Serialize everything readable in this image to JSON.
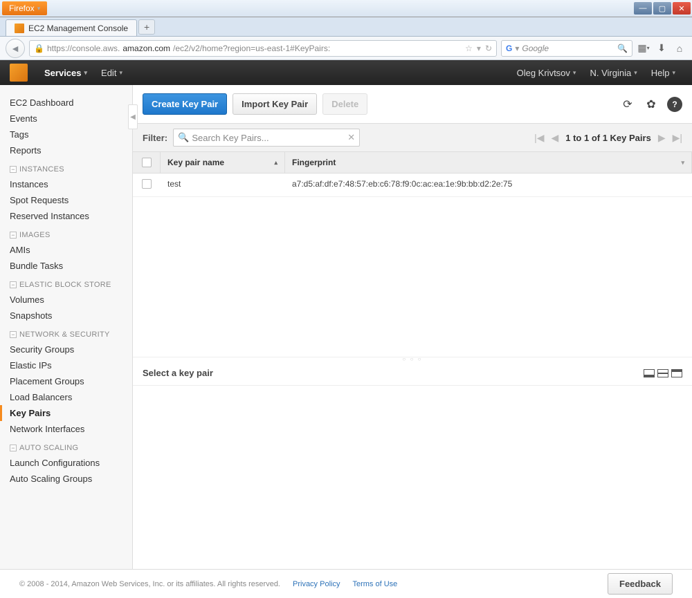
{
  "browser": {
    "app_button": "Firefox",
    "tab_title": "EC2 Management Console",
    "url_prefix": "https://console.aws.",
    "url_bold": "amazon.com",
    "url_suffix": "/ec2/v2/home?region=us-east-1#KeyPairs:",
    "search_placeholder": "Google",
    "search_icon": "G"
  },
  "awsnav": {
    "services": "Services",
    "edit": "Edit",
    "user": "Oleg Krivtsov",
    "region": "N. Virginia",
    "help": "Help"
  },
  "sidebar": {
    "top": [
      "EC2 Dashboard",
      "Events",
      "Tags",
      "Reports"
    ],
    "groups": [
      {
        "title": "INSTANCES",
        "items": [
          "Instances",
          "Spot Requests",
          "Reserved Instances"
        ]
      },
      {
        "title": "IMAGES",
        "items": [
          "AMIs",
          "Bundle Tasks"
        ]
      },
      {
        "title": "ELASTIC BLOCK STORE",
        "items": [
          "Volumes",
          "Snapshots"
        ]
      },
      {
        "title": "NETWORK & SECURITY",
        "items": [
          "Security Groups",
          "Elastic IPs",
          "Placement Groups",
          "Load Balancers",
          "Key Pairs",
          "Network Interfaces"
        ]
      },
      {
        "title": "AUTO SCALING",
        "items": [
          "Launch Configurations",
          "Auto Scaling Groups"
        ]
      }
    ],
    "active": "Key Pairs"
  },
  "toolbar": {
    "create": "Create Key Pair",
    "import": "Import Key Pair",
    "delete": "Delete"
  },
  "filter": {
    "label": "Filter:",
    "placeholder": "Search Key Pairs...",
    "pagination": "1 to 1 of 1 Key Pairs"
  },
  "table": {
    "col_name": "Key pair name",
    "col_fp": "Fingerprint",
    "rows": [
      {
        "name": "test",
        "fp": "a7:d5:af:df:e7:48:57:eb:c6:78:f9:0c:ac:ea:1e:9b:bb:d2:2e:75"
      }
    ]
  },
  "detail": {
    "heading": "Select a key pair"
  },
  "footer": {
    "copyright": "© 2008 - 2014, Amazon Web Services, Inc. or its affiliates. All rights reserved.",
    "privacy": "Privacy Policy",
    "terms": "Terms of Use",
    "feedback": "Feedback"
  }
}
